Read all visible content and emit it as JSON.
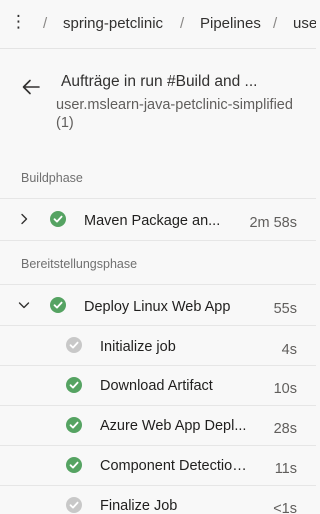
{
  "breadcrumb": {
    "more": "⋮",
    "sep": "/",
    "project": "spring-petclinic",
    "pipelines": "Pipelines",
    "pipeline": "user.mslearn-java-petclinic-simplified"
  },
  "header": {
    "title": "Aufträge in run #Build and ...",
    "subtitle": "user.mslearn-java-petclinic-simplified (1)"
  },
  "sections": {
    "build": "Buildphase",
    "deploy": "Bereitstellungsphase"
  },
  "jobs": [
    {
      "label": "Maven Package an...",
      "duration": "2m 58s",
      "status": "succeeded",
      "expanded": false
    },
    {
      "label": "Deploy Linux Web App",
      "duration": "55s",
      "status": "succeeded",
      "expanded": true
    }
  ],
  "steps": [
    {
      "label": "Initialize job",
      "duration": "4s",
      "status": "skipped"
    },
    {
      "label": "Download Artifact",
      "duration": "10s",
      "status": "succeeded"
    },
    {
      "label": "Azure Web App Depl...",
      "duration": "28s",
      "status": "succeeded"
    },
    {
      "label": "Component Detection...",
      "duration": "11s",
      "status": "succeeded"
    },
    {
      "label": "Finalize Job",
      "duration": "<1s",
      "status": "skipped"
    }
  ],
  "colors": {
    "success": "#55a362",
    "skipped": "#c8c8c8",
    "text": "#201f1e",
    "muted": "#605e5c"
  },
  "icons": {
    "back": "arrow-left-icon",
    "expand": "chevron-right-icon",
    "collapse": "chevron-down-icon",
    "success": "check-circle-icon",
    "skipped": "check-circle-grey-icon"
  }
}
